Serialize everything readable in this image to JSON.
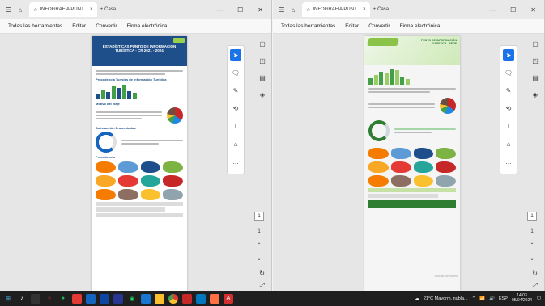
{
  "left_window": {
    "tab_title": "INFOGRAFIA PUNT...",
    "new_tab": "Casa",
    "menu": [
      "Todas las herramientas",
      "Editar",
      "Convertir",
      "Firma electrónica",
      "..."
    ],
    "page_title": "ESTADÍSTICAS PUNTO DE INFORMACIÓN TURÍSTICA - CR 2021 - 2024",
    "sections": [
      "Procedencia Turistas de Información Turística",
      "Motivo del viaje",
      "Satisfacción Encuestados",
      "Procedencia"
    ]
  },
  "right_window": {
    "tab_title": "INFOGRAFIA PUNT...",
    "new_tab": "Casa",
    "menu": [
      "Todas las herramientas",
      "Editar",
      "Convertir",
      "Firma electrónica",
      "..."
    ],
    "page_title": "PUNTO DE INFORMACIÓN TURÍSTICA - SEDE",
    "watermark": "Activar Windows"
  },
  "side": {
    "page_current": "1",
    "page_total": "1"
  },
  "taskbar": {
    "weather": "21°C Mayorm. nubla...",
    "lang": "ESP",
    "time": "14:03",
    "date": "05/04/2024"
  },
  "colors": {
    "accent": "#1a73e8",
    "left_header": "#1e4f8a",
    "right_green": "#43a047"
  }
}
